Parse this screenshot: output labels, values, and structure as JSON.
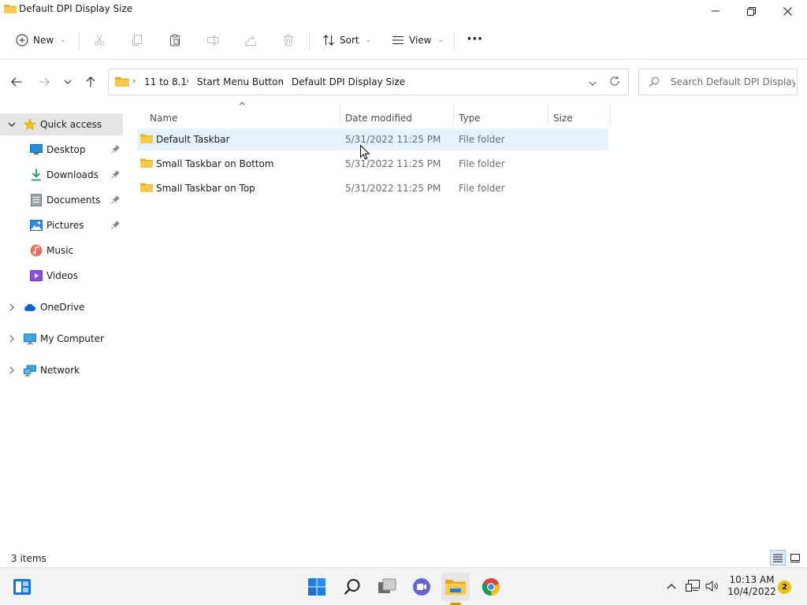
{
  "window": {
    "title": "Default DPI Display Size"
  },
  "commandbar": {
    "new_label": "New",
    "sort_label": "Sort",
    "view_label": "View",
    "more_label": "···"
  },
  "address": {
    "crumbs": [
      "11 to 8.1",
      "Start Menu Button",
      "Default DPI Display Size"
    ],
    "separator": "›"
  },
  "search": {
    "placeholder": "Search Default DPI Display Si..."
  },
  "sidebar": {
    "quick_access": "Quick access",
    "items": [
      {
        "label": "Desktop",
        "icon": "desktop-icon",
        "pinned": true
      },
      {
        "label": "Downloads",
        "icon": "downloads-icon",
        "pinned": true
      },
      {
        "label": "Documents",
        "icon": "documents-icon",
        "pinned": true
      },
      {
        "label": "Pictures",
        "icon": "pictures-icon",
        "pinned": true
      },
      {
        "label": "Music",
        "icon": "music-icon",
        "pinned": false
      },
      {
        "label": "Videos",
        "icon": "videos-icon",
        "pinned": false
      }
    ],
    "roots": [
      {
        "label": "OneDrive",
        "icon": "onedrive-icon"
      },
      {
        "label": "My Computer",
        "icon": "computer-icon"
      },
      {
        "label": "Network",
        "icon": "network-icon"
      }
    ]
  },
  "columns": {
    "name": "Name",
    "date": "Date modified",
    "type": "Type",
    "size": "Size"
  },
  "files": [
    {
      "name": "Default Taskbar",
      "date": "5/31/2022 11:25 PM",
      "type": "File folder"
    },
    {
      "name": "Small Taskbar on Bottom",
      "date": "5/31/2022 11:25 PM",
      "type": "File folder"
    },
    {
      "name": "Small Taskbar on Top",
      "date": "5/31/2022 11:25 PM",
      "type": "File folder"
    }
  ],
  "status": {
    "item_count": "3 items"
  },
  "taskbar": {
    "time": "10:13 AM",
    "date": "10/4/2022",
    "notification_count": "2"
  },
  "colors": {
    "accent": "#0067c0",
    "folder": "#f8c94a",
    "hover_row": "#e5f3ff",
    "selected_nav": "#e5e5e5"
  }
}
